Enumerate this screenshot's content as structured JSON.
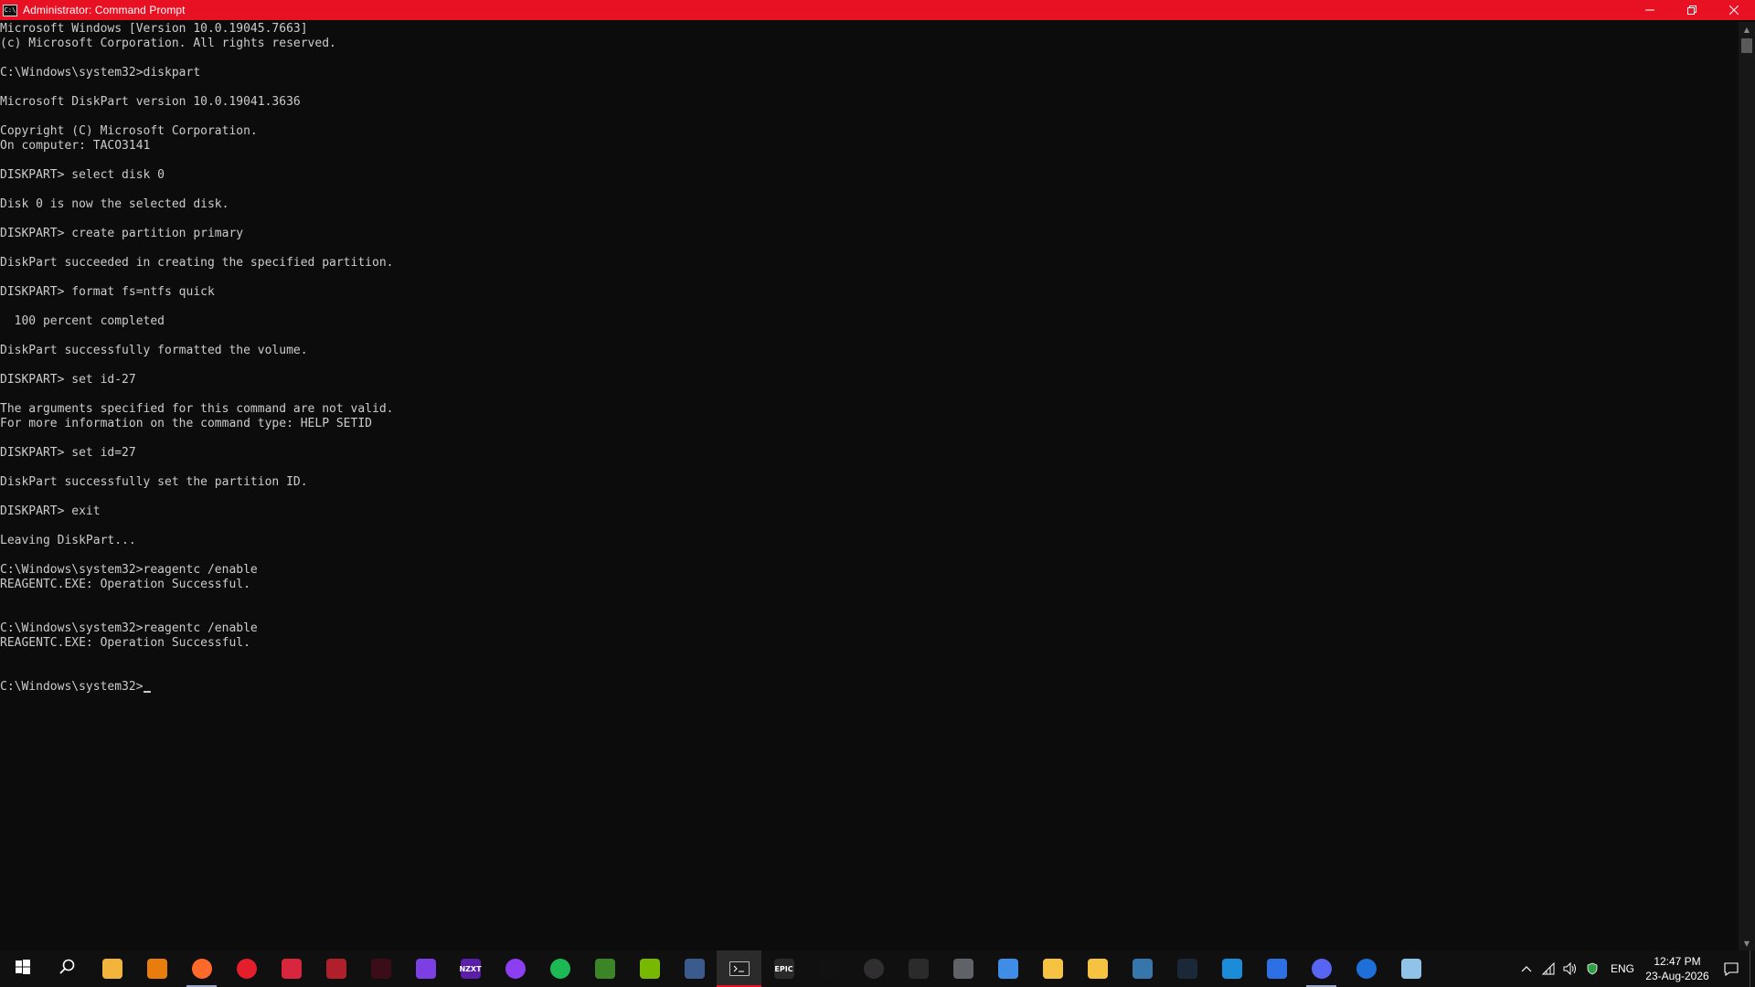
{
  "window": {
    "title": "Administrator: Command Prompt",
    "icon_name": "cmd-icon",
    "controls": [
      "minimize-icon",
      "restore-icon",
      "close-icon"
    ],
    "title_bar_color": "#e81123"
  },
  "console": {
    "lines": [
      "Microsoft Windows [Version 10.0.19045.7663]",
      "(c) Microsoft Corporation. All rights reserved.",
      "",
      "C:\\Windows\\system32>diskpart",
      "",
      "Microsoft DiskPart version 10.0.19041.3636",
      "",
      "Copyright (C) Microsoft Corporation.",
      "On computer: TACO3141",
      "",
      "DISKPART> select disk 0",
      "",
      "Disk 0 is now the selected disk.",
      "",
      "DISKPART> create partition primary",
      "",
      "DiskPart succeeded in creating the specified partition.",
      "",
      "DISKPART> format fs=ntfs quick",
      "",
      "  100 percent completed",
      "",
      "DiskPart successfully formatted the volume.",
      "",
      "DISKPART> set id-27",
      "",
      "The arguments specified for this command are not valid.",
      "For more information on the command type: HELP SETID",
      "",
      "DISKPART> set id=27",
      "",
      "DiskPart successfully set the partition ID.",
      "",
      "DISKPART> exit",
      "",
      "Leaving DiskPart...",
      "",
      "C:\\Windows\\system32>reagentc /enable",
      "REAGENTC.EXE: Operation Successful.",
      "",
      "",
      "C:\\Windows\\system32>reagentc /enable",
      "REAGENTC.EXE: Operation Successful.",
      "",
      "",
      "C:\\Windows\\system32>"
    ],
    "text_color": "#cccccc",
    "background_color": "#0c0c0c"
  },
  "taskbar": {
    "apps": [
      {
        "name": "start-button",
        "icon": "windows-logo-icon"
      },
      {
        "name": "search-button",
        "icon": "search-icon"
      },
      {
        "name": "taskbar-app-photos",
        "icon": "photos-icon",
        "color": "#f2b43c"
      },
      {
        "name": "taskbar-app-blender",
        "icon": "blender-icon",
        "color": "#e87d0d"
      },
      {
        "name": "taskbar-app-firefox",
        "icon": "firefox-icon",
        "color": "#ff6a2b",
        "running": true
      },
      {
        "name": "taskbar-app-red-app",
        "icon": "red-app-icon",
        "color": "#e41e2b"
      },
      {
        "name": "taskbar-app-bolt",
        "icon": "bolt-icon",
        "color": "#d7263d"
      },
      {
        "name": "taskbar-app-game",
        "icon": "game-icon",
        "color": "#b0202a"
      },
      {
        "name": "taskbar-app-valorant",
        "icon": "valorant-icon",
        "color": "#3a0d18"
      },
      {
        "name": "taskbar-app-heart",
        "icon": "heart-icon",
        "color": "#7b3fe4"
      },
      {
        "name": "taskbar-app-nzxt",
        "icon": "nzxt-icon",
        "color": "#5a1ea8",
        "label": "NZXT"
      },
      {
        "name": "taskbar-app-purple-ring",
        "icon": "ring-icon",
        "color": "#8b3ff0"
      },
      {
        "name": "taskbar-app-spotify",
        "icon": "spotify-icon",
        "color": "#1db954"
      },
      {
        "name": "taskbar-app-minecraft",
        "icon": "minecraft-icon",
        "color": "#3c8527"
      },
      {
        "name": "taskbar-app-nvidia",
        "icon": "nvidia-icon",
        "color": "#76b900"
      },
      {
        "name": "taskbar-app-davinci",
        "icon": "davinci-icon",
        "color": "#3b5b8f"
      },
      {
        "name": "taskbar-app-terminal",
        "icon": "terminal-icon",
        "color": "#1e1e1e",
        "active": true
      },
      {
        "name": "taskbar-app-epic",
        "icon": "epic-games-icon",
        "color": "#2a2a2a",
        "label": "EPIC"
      },
      {
        "name": "taskbar-app-capcut",
        "icon": "capcut-icon",
        "color": "#111111"
      },
      {
        "name": "taskbar-app-obs",
        "icon": "obs-icon",
        "color": "#302e31"
      },
      {
        "name": "taskbar-app-grid",
        "icon": "grid-icon",
        "color": "#2b2b2b"
      },
      {
        "name": "taskbar-app-unity",
        "icon": "unity-icon",
        "color": "#5f6368"
      },
      {
        "name": "taskbar-app-paint",
        "icon": "paint-icon",
        "color": "#3f8de6"
      },
      {
        "name": "taskbar-app-explorer",
        "icon": "folder-icon",
        "color": "#f5c242"
      },
      {
        "name": "taskbar-app-maps",
        "icon": "maps-icon",
        "color": "#f5c242"
      },
      {
        "name": "taskbar-app-python",
        "icon": "python-icon",
        "color": "#3776ab"
      },
      {
        "name": "taskbar-app-steam",
        "icon": "steam-icon",
        "color": "#1b2838"
      },
      {
        "name": "taskbar-app-pulse",
        "icon": "pulse-icon",
        "color": "#1a8cd8"
      },
      {
        "name": "taskbar-app-roblox",
        "icon": "roblox-icon",
        "color": "#2f6fe4"
      },
      {
        "name": "taskbar-app-discord",
        "icon": "discord-icon",
        "color": "#5865f2",
        "running": true
      },
      {
        "name": "taskbar-app-bing",
        "icon": "bing-icon",
        "color": "#1e6fd9"
      },
      {
        "name": "taskbar-app-notepad",
        "icon": "notepad-icon",
        "color": "#8fc4e8"
      }
    ],
    "tray": {
      "icons": [
        "chevron-up-icon",
        "network-icon",
        "volume-icon",
        "security-icon"
      ],
      "language": "ENG",
      "time": "12:47 PM",
      "date": "23-Aug-2026"
    }
  }
}
